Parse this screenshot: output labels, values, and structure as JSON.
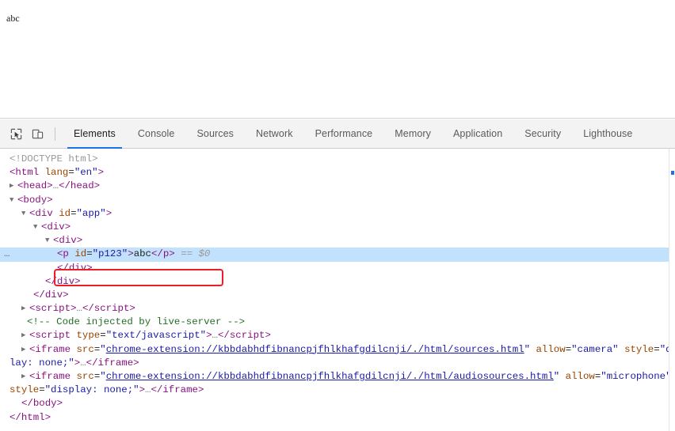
{
  "page": {
    "body_text": "abc"
  },
  "devtools": {
    "toolbar": {
      "inspect_icon": "inspect-cursor-icon",
      "device_icon": "device-toolbar-icon",
      "tabs": [
        {
          "label": "Elements",
          "active": true
        },
        {
          "label": "Console",
          "active": false
        },
        {
          "label": "Sources",
          "active": false
        },
        {
          "label": "Network",
          "active": false
        },
        {
          "label": "Performance",
          "active": false
        },
        {
          "label": "Memory",
          "active": false
        },
        {
          "label": "Application",
          "active": false
        },
        {
          "label": "Security",
          "active": false
        },
        {
          "label": "Lighthouse",
          "active": false
        }
      ]
    },
    "dom_tree": {
      "selected_node_marker": "…",
      "lines": {
        "doctype": "<!DOCTYPE html>",
        "html_open_tag": "<html",
        "html_attr_name": "lang",
        "html_attr_value": "\"en\"",
        "head_open": "<head>",
        "head_ellipsis": "…",
        "head_close": "</head>",
        "body_open": "<body>",
        "div_app_open": "<div",
        "div_app_attr": "id",
        "div_app_value": "\"app\"",
        "div2_open": "<div>",
        "div3_open": "<div>",
        "p_open": "<p",
        "p_attr": "id",
        "p_value": "\"p123\"",
        "p_text": "abc",
        "p_close": "</p>",
        "p_ref": "== $0",
        "div3_close": "</div>",
        "div2_close": "</div>",
        "div_app_close": "</div>",
        "script1_open": "<script>",
        "script1_ellipsis": "…",
        "script1_close": "</script>",
        "comment": "<!-- Code injected by live-server -->",
        "script2_open": "<script",
        "script2_attr": "type",
        "script2_value": "\"text/javascript\"",
        "script2_ellipsis": "…",
        "script2_close": "</script>",
        "iframe1_open": "<iframe",
        "iframe1_src_attr": "src",
        "iframe1_src_value": "chrome-extension://kbbdabhdfibnancpjfhlkhafgdilcnji/./html/sources.html",
        "iframe1_allow_attr": "allow",
        "iframe1_allow_value": "\"camera\"",
        "iframe1_style_attr": "style",
        "iframe1_style_value_part1": "\"disp",
        "iframe1_style_value_part2": "lay: none;\"",
        "iframe1_ellipsis": "…",
        "iframe1_close": "</iframe>",
        "iframe2_open": "<iframe",
        "iframe2_src_attr": "src",
        "iframe2_src_value": "chrome-extension://kbbdabhdfibnancpjfhlkhafgdilcnji/./html/audiosources.html",
        "iframe2_allow_attr": "allow",
        "iframe2_allow_value": "\"microphone\"",
        "iframe2_style_attr": "style",
        "iframe2_style_value": "\"display: none;\"",
        "iframe2_ellipsis": "…",
        "iframe2_close": "</iframe>",
        "body_close": "</body>",
        "html_close": "</html>"
      }
    }
  },
  "annotation": {
    "highlight_color": "#ee1c25",
    "selection_color": "#c2e1fc",
    "accent_color": "#1a73e8"
  }
}
